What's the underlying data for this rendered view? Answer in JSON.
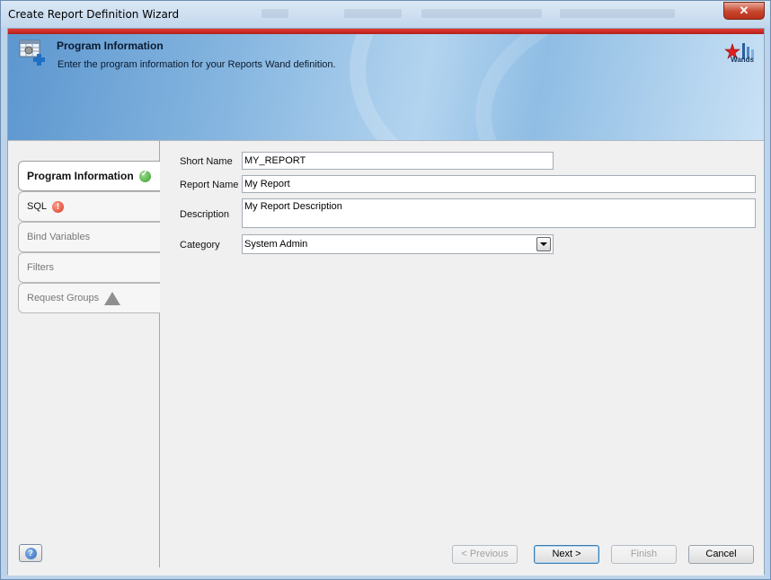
{
  "window": {
    "title": "Create Report Definition Wizard",
    "close_label": "✕"
  },
  "banner": {
    "title": "Program Information",
    "subtitle": "Enter the program information for your Reports Wand definition.",
    "logo_text": "Wands"
  },
  "nav": {
    "items": [
      {
        "label": "Program Information",
        "status": "complete"
      },
      {
        "label": "SQL",
        "status": "error"
      },
      {
        "label": "Bind Variables",
        "status": "none"
      },
      {
        "label": "Filters",
        "status": "none"
      },
      {
        "label": "Request Groups",
        "status": "warning"
      }
    ]
  },
  "form": {
    "short_name": {
      "label": "Short Name",
      "value": "MY_REPORT"
    },
    "report_name": {
      "label": "Report Name",
      "value": "My Report"
    },
    "description": {
      "label": "Description",
      "value": "My Report Description"
    },
    "category": {
      "label": "Category",
      "value": "System Admin"
    }
  },
  "buttons": {
    "previous": "< Previous",
    "next": "Next >",
    "finish": "Finish",
    "cancel": "Cancel"
  },
  "colors": {
    "accent_red": "#c7452c",
    "banner_blue": "#86b6e0",
    "ok_green": "#3a9a2f",
    "error_red": "#d93a22"
  }
}
